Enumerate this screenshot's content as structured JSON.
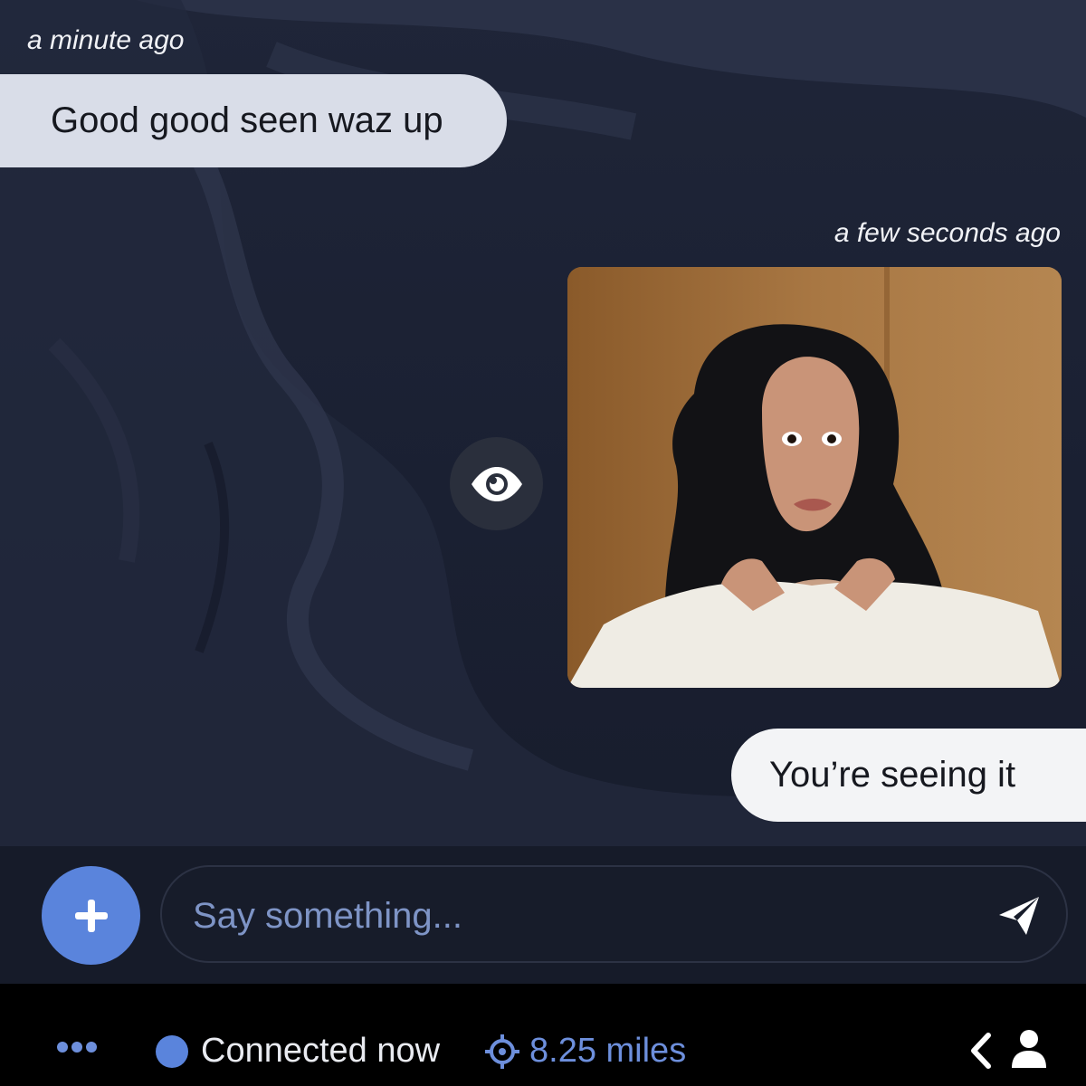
{
  "messages": {
    "received": {
      "timestamp": "a minute ago",
      "text": "Good good seen waz up"
    },
    "sent_gif": {
      "timestamp": "a few seconds ago",
      "icon": "eye-icon"
    },
    "sent_text": {
      "text": "You’re seeing it"
    }
  },
  "composer": {
    "placeholder": "Say something...",
    "add_icon": "plus-icon",
    "send_icon": "paper-plane-icon"
  },
  "status_bar": {
    "more_icon": "more-dots-icon",
    "connection": "Connected now",
    "distance": "8.25 miles",
    "distance_icon": "crosshair-icon",
    "back_icon": "chevron-left-icon",
    "profile_icon": "person-icon"
  },
  "colors": {
    "accent": "#5a84dc",
    "background": "#1b2030",
    "received_bubble": "#d9dde8",
    "sent_bubble": "#f3f4f6"
  }
}
